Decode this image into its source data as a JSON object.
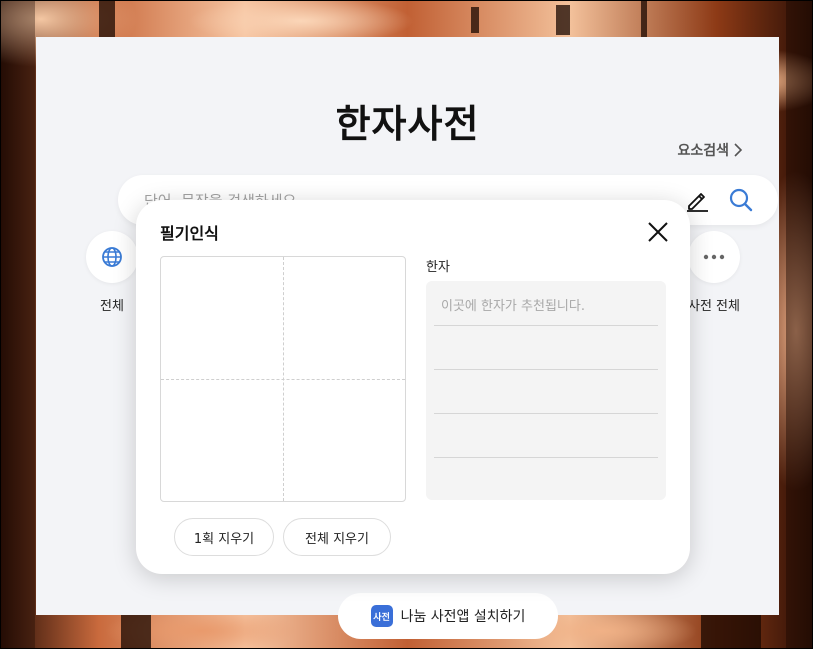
{
  "page": {
    "title": "한자사전",
    "element_search_label": "요소검색"
  },
  "search": {
    "placeholder": "단어, 문장을 검색하세요",
    "value": ""
  },
  "categories": [
    {
      "label": "전체",
      "icon": "globe-icon"
    },
    {
      "label": "사전 전체",
      "icon": "more-dots-icon"
    }
  ],
  "install": {
    "label": "나눔 사전앱 설치하기",
    "app_icon_text": "사전"
  },
  "handwriting_modal": {
    "title": "필기인식",
    "hanja_label": "한자",
    "suggestion_hint": "이곳에 한자가 추천됩니다.",
    "undo_stroke_label": "1획 지우기",
    "clear_all_label": "전체 지우기"
  },
  "colors": {
    "accent_blue": "#3a7bd5",
    "panel_bg": "#f3f4f7",
    "suggest_bg": "#f4f4f4"
  }
}
